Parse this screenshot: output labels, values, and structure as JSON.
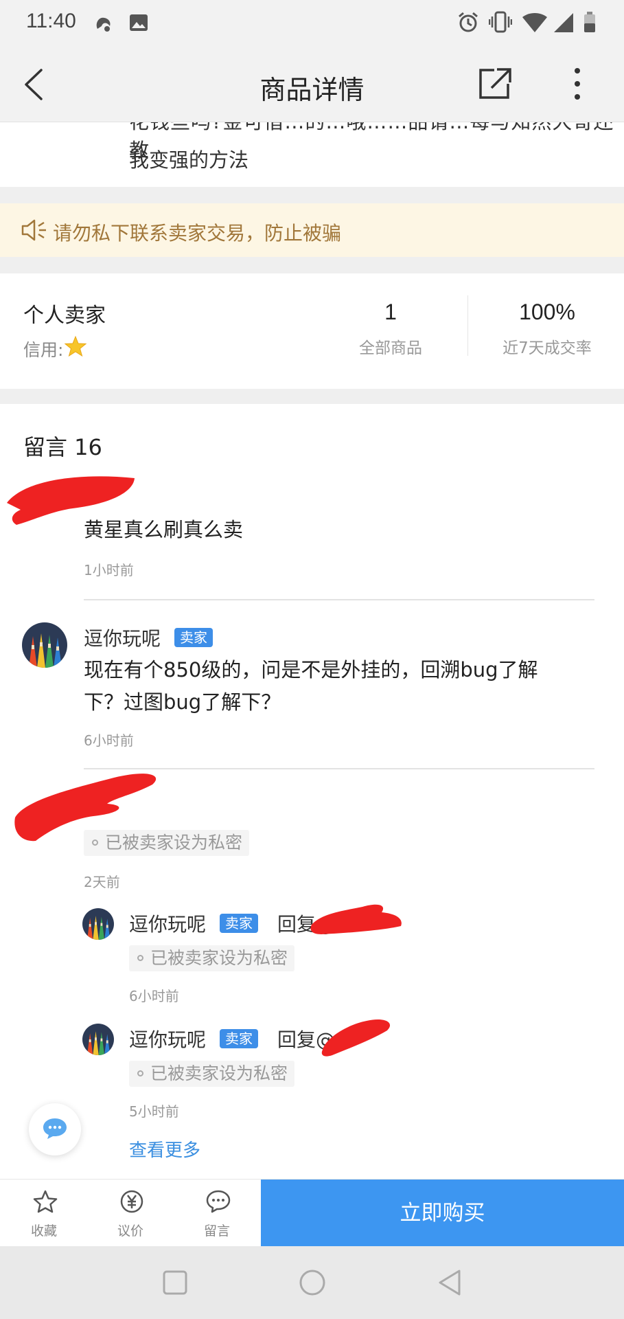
{
  "status_bar": {
    "time": "11:40"
  },
  "header": {
    "title": "商品详情"
  },
  "description": {
    "clipped_line": "花钱些吗?金可借…的…哦……品请…每与知然大哥还教",
    "last_line": "我变强的方法"
  },
  "notice": {
    "text": "请勿私下联系卖家交易，防止被骗"
  },
  "seller": {
    "name": "个人卖家",
    "credit_label": "信用:",
    "stats": [
      {
        "value": "1",
        "label": "全部商品"
      },
      {
        "value": "100%",
        "label": "近7天成交率"
      }
    ]
  },
  "comments": {
    "title": "留言 16",
    "items": [
      {
        "text": "黄星真么刷真么卖",
        "time": "1小时前"
      },
      {
        "name": "逗你玩呢",
        "badge": "卖家",
        "text_line1": "现在有个850级的，问是不是外挂的，回溯bug了解",
        "text_line2": "下？过图bug了解下？",
        "time": "6小时前"
      },
      {
        "private": "已被卖家设为私密",
        "time": "2天前",
        "replies": [
          {
            "name": "逗你玩呢",
            "badge": "卖家",
            "reply": "回复@",
            "private": "已被卖家设为私密",
            "time": "6小时前"
          },
          {
            "name": "逗你玩呢",
            "badge": "卖家",
            "reply": "回复@",
            "private": "已被卖家设为私密",
            "time": "5小时前"
          }
        ],
        "more": "查看更多"
      }
    ]
  },
  "bottom_bar": {
    "items": [
      {
        "label": "收藏",
        "icon": "star-icon"
      },
      {
        "label": "议价",
        "icon": "yuan-icon"
      },
      {
        "label": "留言",
        "icon": "chat-icon"
      }
    ],
    "buy_label": "立即购买"
  },
  "colors": {
    "accent": "#3d96f1",
    "badge": "#3d8ee8",
    "notice_bg": "#fdf6e4",
    "notice_text": "#a1773a",
    "link": "#3b8fe0"
  }
}
